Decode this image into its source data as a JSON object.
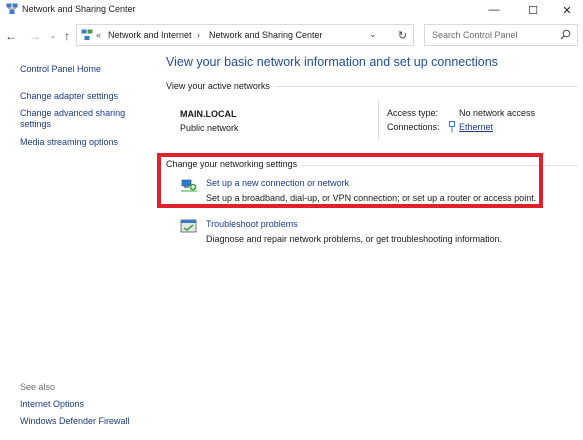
{
  "window": {
    "title": "Network and Sharing Center",
    "controls": {
      "minimize": "—",
      "maximize": "☐",
      "close": "✕"
    }
  },
  "navigation": {
    "back": "←",
    "forward": "→",
    "recent": "⌄",
    "up": "↑",
    "breadcrumb_overflow": "«",
    "breadcrumbs": [
      "Network and Internet",
      "Network and Sharing Center"
    ],
    "separator": "›",
    "dropdown": "⌄",
    "refresh": "↻",
    "search_placeholder": "Search Control Panel"
  },
  "sidebar": {
    "links": [
      "Control Panel Home",
      "Change adapter settings",
      "Change advanced sharing settings",
      "Media streaming options"
    ],
    "see_also_label": "See also",
    "see_also_links": [
      "Internet Options",
      "Windows Defender Firewall"
    ]
  },
  "main": {
    "title": "View your basic network information and set up connections",
    "active_networks_label": "View your active networks",
    "network": {
      "name": "MAIN.LOCAL",
      "category": "Public network",
      "access_type_label": "Access type:",
      "access_type_value": "No network access",
      "connections_label": "Connections:",
      "connections_value": "Ethernet"
    },
    "change_settings_label": "Change your networking settings",
    "tasks": [
      {
        "icon": "new-connection-icon",
        "title": "Set up a new connection or network",
        "description": "Set up a broadband, dial-up, or VPN connection; or set up a router or access point."
      },
      {
        "icon": "troubleshoot-icon",
        "title": "Troubleshoot problems",
        "description": "Diagnose and repair network problems, or get troubleshooting information."
      }
    ]
  },
  "colors": {
    "link": "#1a3a8c",
    "title": "#1e4e9c",
    "highlight": "#e0202a"
  }
}
